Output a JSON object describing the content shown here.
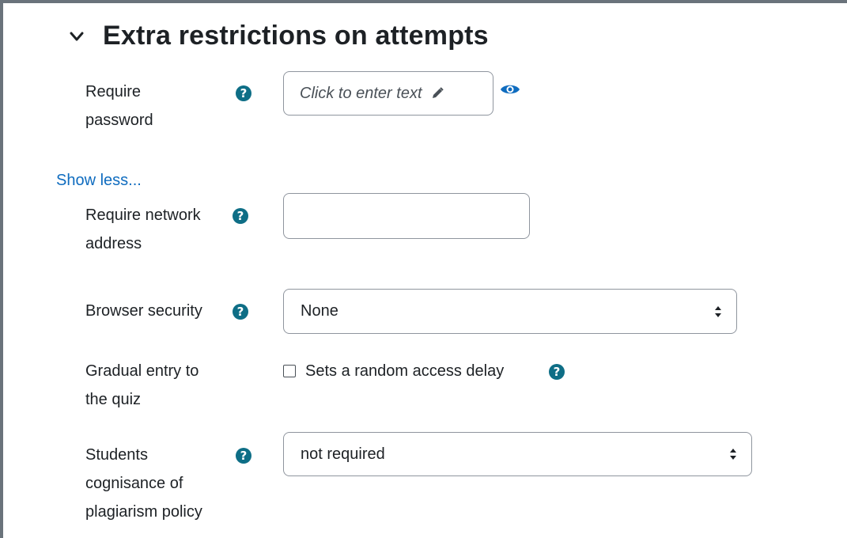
{
  "section": {
    "title": "Extra restrictions on attempts"
  },
  "fields": {
    "password": {
      "label_line1": "Require",
      "label_line2": "password",
      "value": "Click to enter text"
    },
    "show_less": "Show less...",
    "network": {
      "label_line1": "Require network",
      "label_line2": "address",
      "value": ""
    },
    "browser_security": {
      "label": "Browser security",
      "selected": "None"
    },
    "gradual_entry": {
      "label_line1": "Gradual entry to",
      "label_line2": "the quiz",
      "checkbox_label": "Sets a random access delay",
      "checked": false
    },
    "plagiarism": {
      "label_line1": "Students",
      "label_line2": "cognisance of",
      "label_line3": "plagiarism policy",
      "selected": "not required"
    }
  },
  "colors": {
    "help_icon": "#0e6e86",
    "link": "#0f6cbf",
    "frame_border": "#6a737b"
  },
  "icons": [
    "chevron-down-icon",
    "question-circle-icon",
    "pencil-icon",
    "eye-icon",
    "select-caret-icon"
  ]
}
